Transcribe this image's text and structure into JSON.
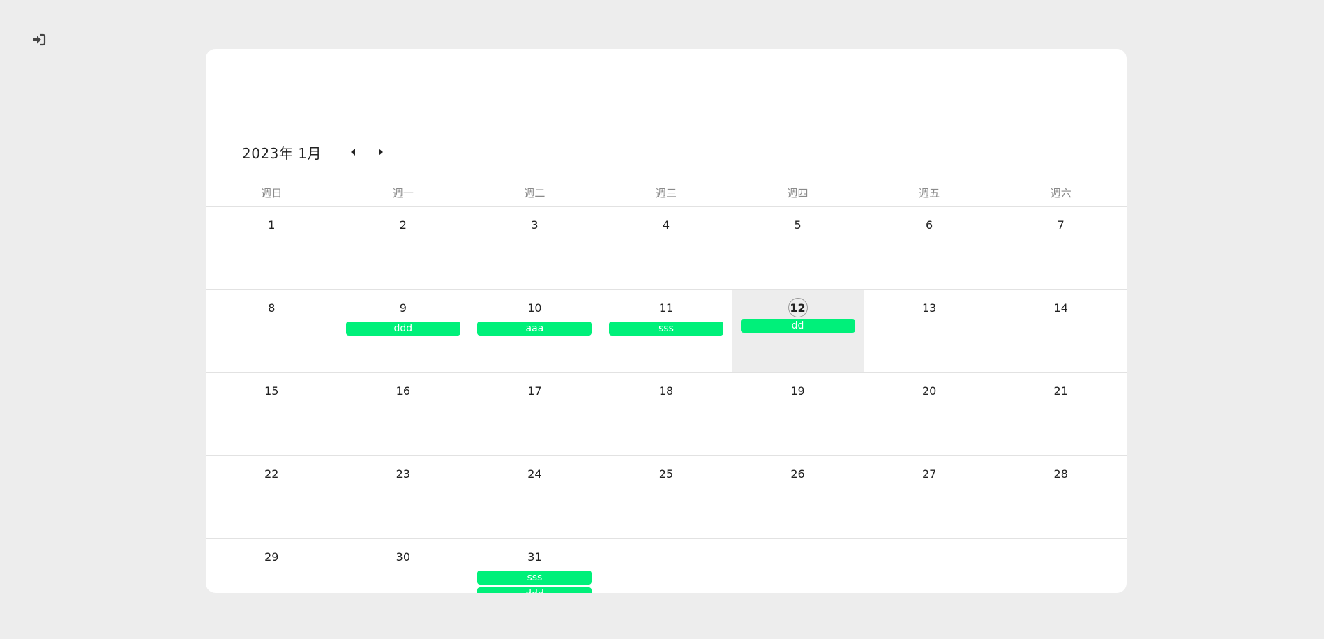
{
  "logout": {
    "icon": "sign-in-icon"
  },
  "calendar": {
    "title": "2023年 1月",
    "prev_icon": "caret-left-icon",
    "next_icon": "caret-right-icon",
    "weekdays": [
      "週日",
      "週一",
      "週二",
      "週三",
      "週四",
      "週五",
      "週六"
    ],
    "today": "12",
    "event_color": "#00f07a",
    "weeks": [
      [
        {
          "day": "1",
          "events": []
        },
        {
          "day": "2",
          "events": []
        },
        {
          "day": "3",
          "events": []
        },
        {
          "day": "4",
          "events": []
        },
        {
          "day": "5",
          "events": []
        },
        {
          "day": "6",
          "events": []
        },
        {
          "day": "7",
          "events": []
        }
      ],
      [
        {
          "day": "8",
          "events": []
        },
        {
          "day": "9",
          "events": [
            "ddd"
          ]
        },
        {
          "day": "10",
          "events": [
            "aaa"
          ]
        },
        {
          "day": "11",
          "events": [
            "sss"
          ]
        },
        {
          "day": "12",
          "events": [
            "dd"
          ]
        },
        {
          "day": "13",
          "events": []
        },
        {
          "day": "14",
          "events": []
        }
      ],
      [
        {
          "day": "15",
          "events": []
        },
        {
          "day": "16",
          "events": []
        },
        {
          "day": "17",
          "events": []
        },
        {
          "day": "18",
          "events": []
        },
        {
          "day": "19",
          "events": []
        },
        {
          "day": "20",
          "events": []
        },
        {
          "day": "21",
          "events": []
        }
      ],
      [
        {
          "day": "22",
          "events": []
        },
        {
          "day": "23",
          "events": []
        },
        {
          "day": "24",
          "events": []
        },
        {
          "day": "25",
          "events": []
        },
        {
          "day": "26",
          "events": []
        },
        {
          "day": "27",
          "events": []
        },
        {
          "day": "28",
          "events": []
        }
      ],
      [
        {
          "day": "29",
          "events": []
        },
        {
          "day": "30",
          "events": []
        },
        {
          "day": "31",
          "events": [
            "sss",
            "ddd"
          ]
        },
        {
          "day": "",
          "events": []
        },
        {
          "day": "",
          "events": []
        },
        {
          "day": "",
          "events": []
        },
        {
          "day": "",
          "events": []
        }
      ]
    ]
  }
}
